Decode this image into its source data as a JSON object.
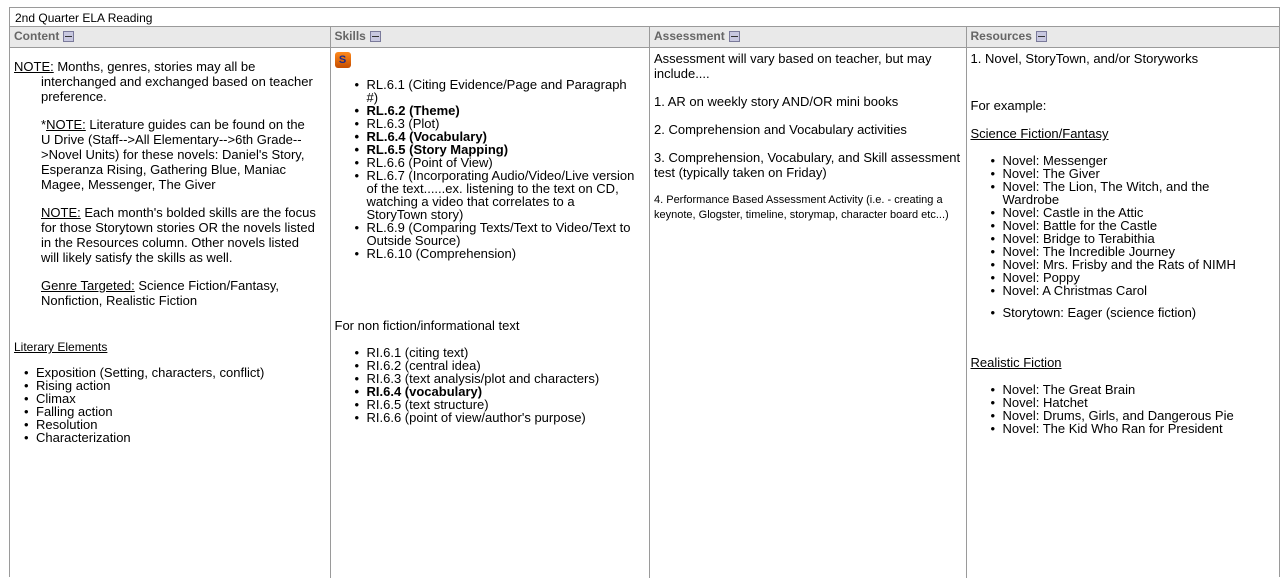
{
  "page": {
    "title": "2nd Quarter ELA Reading"
  },
  "headers": {
    "content": "Content",
    "skills": "Skills",
    "assessment": "Assessment",
    "resources": "Resources"
  },
  "content": {
    "note1_label": "NOTE:",
    "note1_text": " Months, genres, stories may all be interchanged and exchanged based on teacher preference.",
    "note2_star": "*",
    "note2_label": "NOTE:",
    "note2_text": " Literature guides can be found on the U Drive (Staff-->All Elementary-->6th Grade-->Novel Units) for these novels: Daniel's Story, Esperanza Rising, Gathering Blue, Maniac Magee, Messenger, The Giver",
    "note3_label": "NOTE:",
    "note3_text": " Each month's bolded skills are the focus for those Storytown stories OR the novels listed in the Resources column. Other novels listed will likely satisfy the skills as well.",
    "genre_label": "Genre Targeted:",
    "genre_text": " Science Fiction/Fantasy, Nonfiction, Realistic Fiction",
    "literary_label": "Literary Elements",
    "literary_items": [
      "Exposition (Setting, characters, conflict)",
      "Rising action",
      "Climax",
      "Falling action",
      "Resolution",
      "Characterization"
    ]
  },
  "skills": {
    "rl_items": [
      "RL.6.1 (Citing Evidence/Page and Paragraph #)",
      "RL.6.2 (Theme)",
      "RL.6.3 (Plot)",
      "RL.6.4 (Vocabulary)",
      "RL.6.5 (Story Mapping)",
      "RL.6.6 (Point of View)",
      "RL.6.7 (Incorporating Audio/Video/Live version of the text......ex. listening to the text on CD, watching a video that correlates to a StoryTown story)",
      "RL.6.9 (Comparing Texts/Text to Video/Text to Outside Source)",
      "RL.6.10 (Comprehension)"
    ],
    "nonfiction_label": "For non fiction/informational text",
    "ri_items": [
      "RI.6.1 (citing text)",
      "RI.6.2 (central idea)",
      "RI.6.3 (text analysis/plot and characters)",
      "RI.6.4 (vocabulary)",
      "RI.6.5 (text structure)",
      "RI.6.6 (point of view/author's purpose)"
    ]
  },
  "assessment": {
    "intro": "Assessment will vary based on teacher, but may include....",
    "item1": "1. AR on weekly story AND/OR mini books",
    "item2": "2. Comprehension and Vocabulary activities",
    "item3": "3. Comprehension, Vocabulary, and Skill assessment test (typically taken on Friday)",
    "item4": "4. Performance Based Assessment Activity (i.e. - creating a keynote, Glogster, timeline, storymap, character board etc...)"
  },
  "resources": {
    "intro": "1. Novel, StoryTown, and/or Storyworks",
    "example": "For example:",
    "scifi_label": "Science Fiction/Fantasy",
    "scifi_items": [
      "Novel: Messenger",
      "Novel: The Giver",
      "Novel: The Lion, The Witch, and the Wardrobe",
      "Novel: Castle in the Attic",
      "Novel: Battle for the Castle",
      "Novel: Bridge to Terabithia",
      "Novel: The Incredible Journey",
      "Novel: Mrs. Frisby and the Rats of NIMH",
      "Novel: Poppy",
      "Novel: A Christmas Carol"
    ],
    "storytown_item": "Storytown: Eager (science fiction)",
    "realistic_label": "Realistic Fiction",
    "realistic_items": [
      "Novel: The Great Brain",
      "Novel: Hatchet",
      "Novel: Drums, Girls, and Dangerous Pie",
      "Novel: The Kid Who Ran for President"
    ]
  }
}
